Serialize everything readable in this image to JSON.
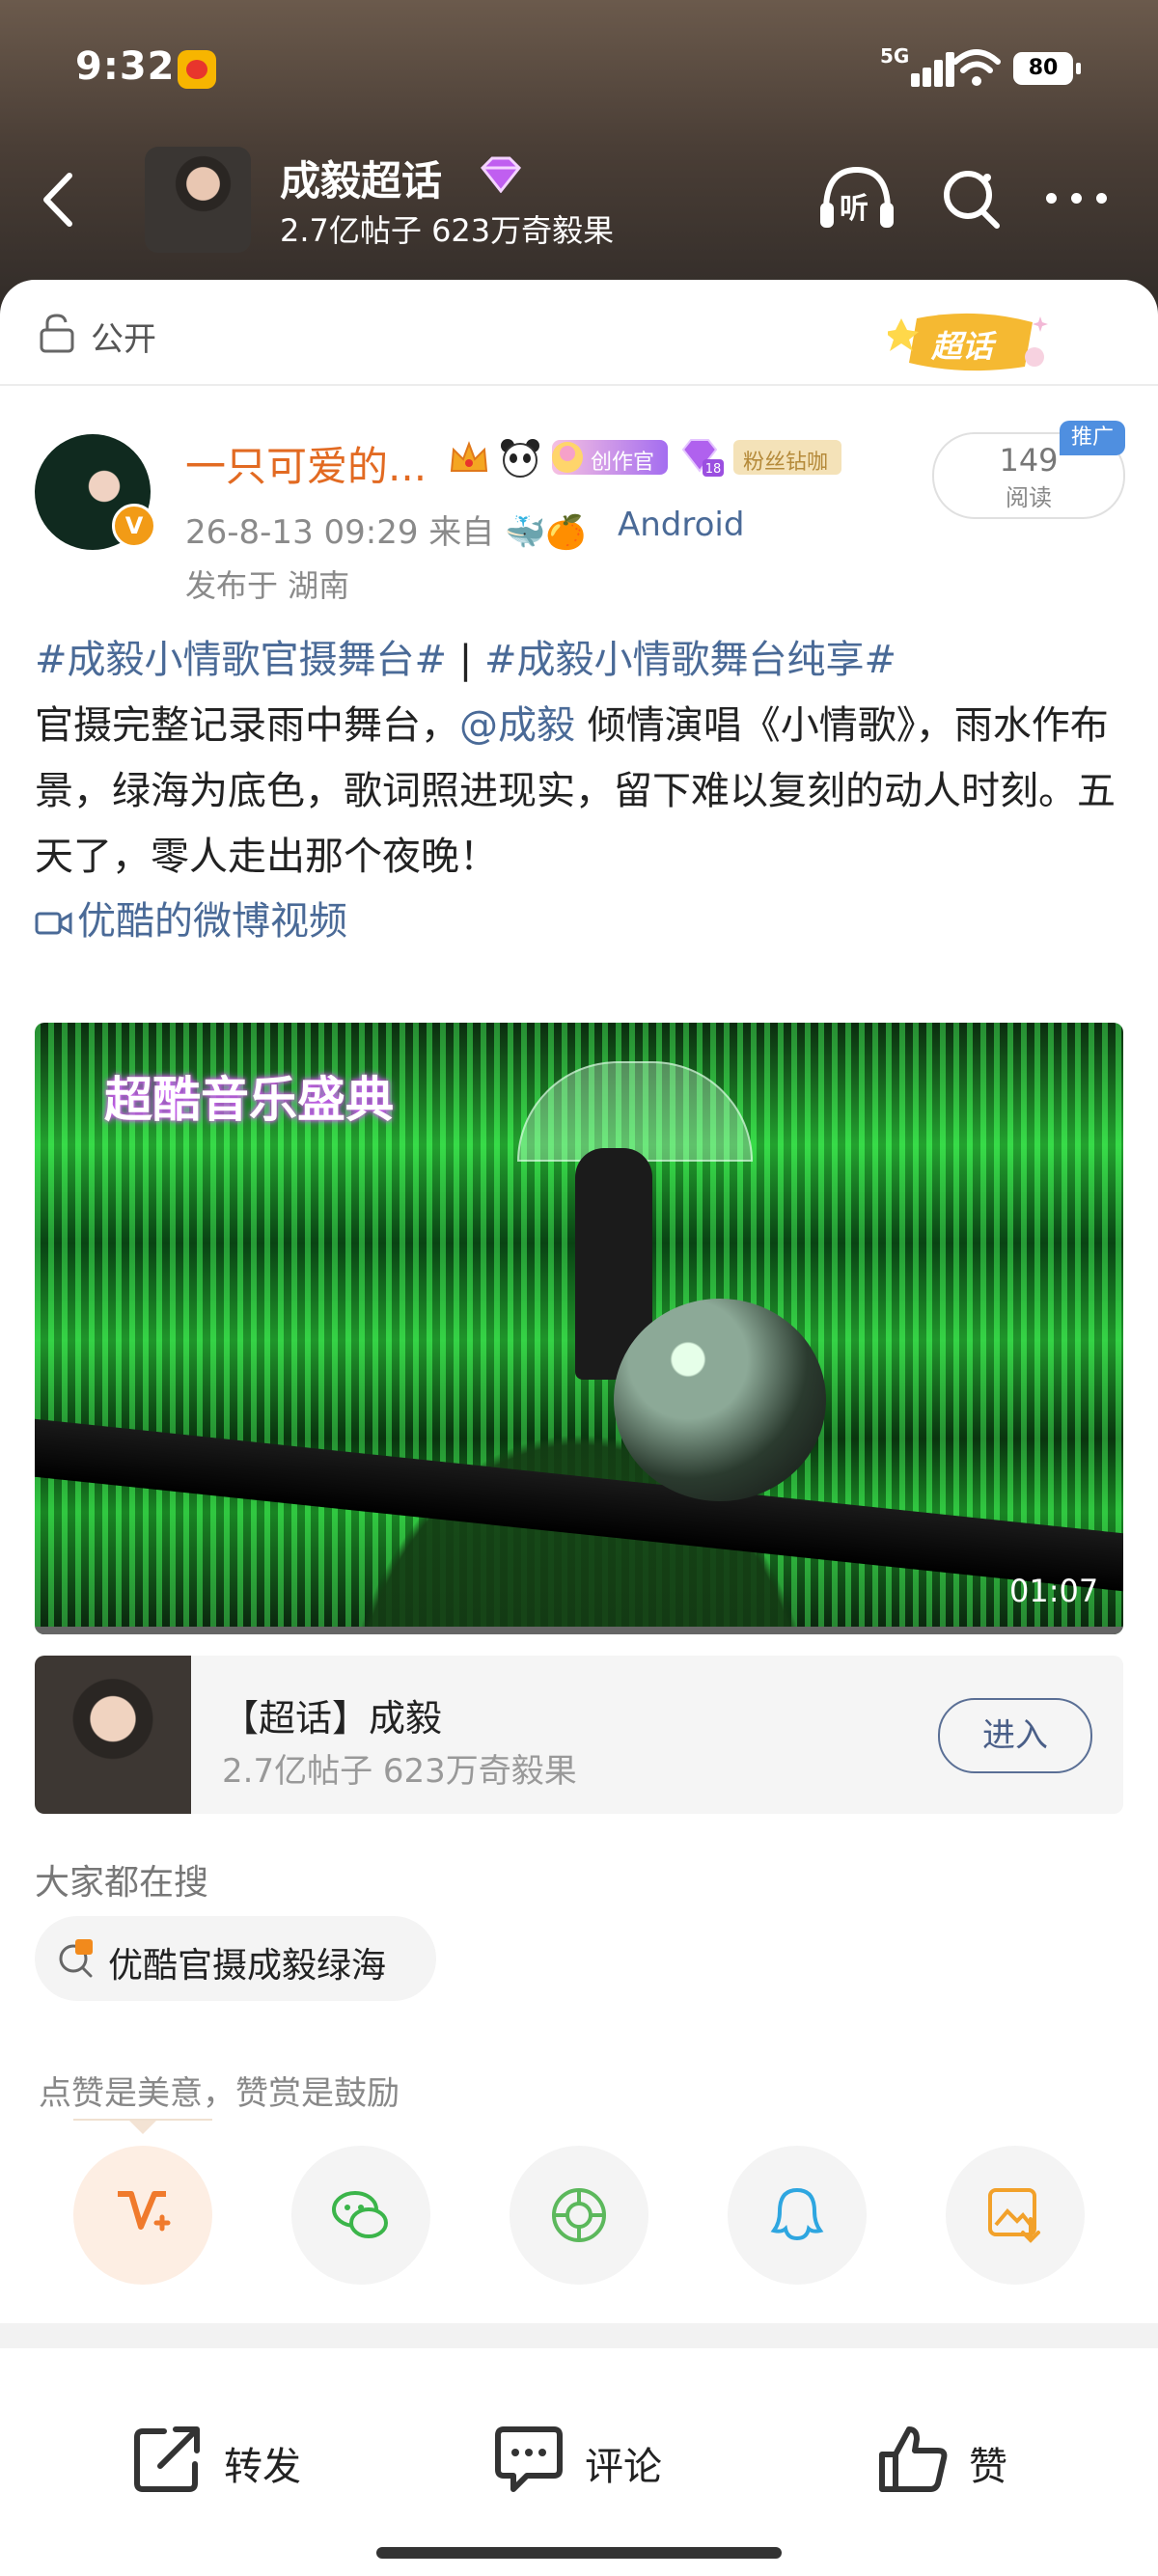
{
  "status_bar": {
    "time": "9:32",
    "network": "5G",
    "battery": "80"
  },
  "header": {
    "topic_name": "成毅超话",
    "topic_stats": "2.7亿帖子 623万奇毅果",
    "listen_label": "听"
  },
  "visibility": {
    "label": "公开",
    "badge": "超话"
  },
  "post": {
    "author_name": "一只可爱的...",
    "badges": {
      "creator": "创作官",
      "fan": "粉丝钻咖",
      "gem_level": "18"
    },
    "verified_mark": "V",
    "meta": "26-8-13 09:29   来自 🐳🍊",
    "source_app": "Android",
    "location": "发布于 湖南",
    "read_count": "149",
    "read_label": "阅读",
    "promo_tag": "推广",
    "hashtag1": "#成毅小情歌官摄舞台#",
    "separator": " | ",
    "hashtag2": "#成毅小情歌舞台纯享#",
    "text_before_mention": "官摄完整记录雨中舞台，",
    "mention": "@成毅",
    "text_after_mention": " 倾情演唱《小情歌》，雨水作布景，绿海为底色，歌词照进现实，留下难以复刻的动人时刻。五天了，零人走出那个夜晚！",
    "video_link": "优酷的微博视频",
    "video": {
      "overlay_text": "超酷音乐盛典",
      "duration": "01:07"
    }
  },
  "topic_card": {
    "title": "【超话】成毅",
    "stats": "2.7亿帖子 623万奇毅果",
    "enter_label": "进入"
  },
  "trending": {
    "label": "大家都在搜",
    "chip": "优酷官摄成毅绿海"
  },
  "reward": {
    "text": "点赞是美意，赞赏是鼓励",
    "share_icons": [
      "reward-icon",
      "wechat-icon",
      "moments-icon",
      "qq-icon",
      "save-image-icon"
    ]
  },
  "actions": {
    "repost": "转发",
    "comment": "评论",
    "like": "赞"
  },
  "colors": {
    "author_name": "#e26a22",
    "link": "#4a6a97",
    "verified": "#f29b16"
  }
}
